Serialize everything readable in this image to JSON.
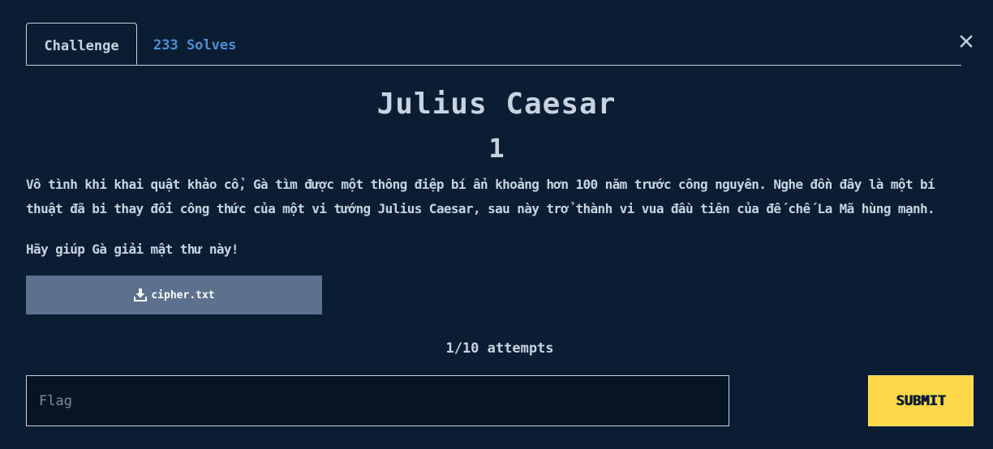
{
  "tabs": {
    "challenge": "Challenge",
    "solves": "233 Solves"
  },
  "challenge": {
    "name": "Julius Caesar",
    "points": "1",
    "description": "Vô tình khi khai quật khảo cổ, Gà tìm được một thông điệp bí ẩn khoảng hơn 100 năm trước công nguyên. Nghe đồn đây là một bí thuật đã bi thay đổi công thức của một vi tướng Julius Caesar, sau này trở thành vi vua đầu tiên của đế chế La Mã hùng mạnh.",
    "hint": "Hãy giúp Gà giải mật thư này!",
    "file": "cipher.txt",
    "attempts": "1/10 attempts"
  },
  "form": {
    "flag_placeholder": "Flag",
    "flag_value": "",
    "submit_label": "SUBMIT"
  },
  "icons": {
    "close": "close-icon",
    "download": "download-icon"
  },
  "colors": {
    "background": "#0b1d33",
    "text": "#c9d3e0",
    "link": "#4a8fd6",
    "file_button": "#5c718d",
    "submit": "#ffd84a"
  }
}
